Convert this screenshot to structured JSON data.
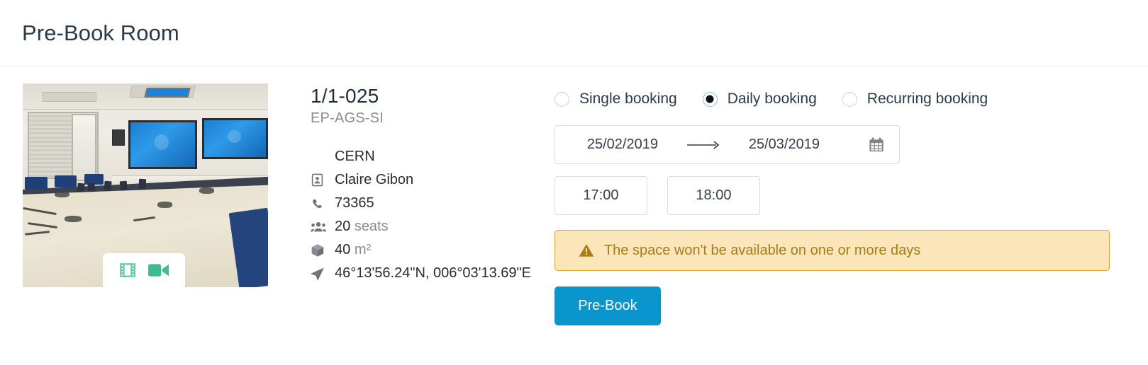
{
  "header": {
    "title": "Pre-Book Room"
  },
  "room": {
    "photo_alt": "meeting-room-photo",
    "media_icons": [
      {
        "name": "film-strip-icon",
        "color": "#5fc9a0"
      },
      {
        "name": "video-camera-icon",
        "color": "#3dbd8e"
      }
    ],
    "name": "1/1-025",
    "department": "EP-AGS-SI",
    "details": [
      {
        "icon": "",
        "label": "CERN",
        "unit": ""
      },
      {
        "icon": "id-card-icon",
        "label": "Claire Gibon",
        "unit": ""
      },
      {
        "icon": "phone-icon",
        "label": "73365",
        "unit": ""
      },
      {
        "icon": "users-icon",
        "label": "20",
        "unit": "seats"
      },
      {
        "icon": "box-icon",
        "label": "40",
        "unit": "m²"
      },
      {
        "icon": "location-arrow-icon",
        "label": "46°13'56.24\"N, 006°03'13.69\"E",
        "unit": ""
      }
    ]
  },
  "booking": {
    "types": [
      {
        "label": "Single booking",
        "checked": false
      },
      {
        "label": "Daily booking",
        "checked": true
      },
      {
        "label": "Recurring booking",
        "checked": false
      }
    ],
    "date_range": {
      "start": "25/02/2019",
      "separator": "→",
      "end": "25/03/2019",
      "calendar_icon": "calendar-icon"
    },
    "times": {
      "start": "17:00",
      "end": "18:00"
    },
    "warning": {
      "icon": "warning-triangle-icon",
      "text": "The space won't be available on one or more days",
      "background": "#fce6b9",
      "border": "#d8a82a",
      "text_color": "#a67d18"
    },
    "submit": {
      "label": "Pre-Book",
      "color": "#0b95cd"
    }
  }
}
